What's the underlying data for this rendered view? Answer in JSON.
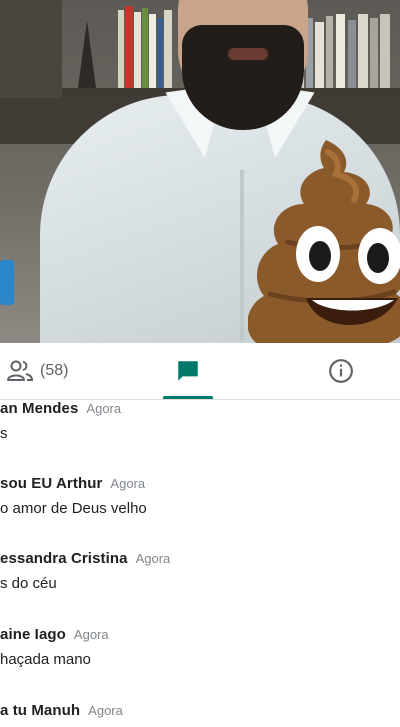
{
  "video": {
    "reaction_emoji": "pile-of-poo"
  },
  "tabs": {
    "people_count": "(58)",
    "people_icon": "people-icon",
    "chat_icon": "chat-icon",
    "info_icon": "info-icon",
    "accent": "#00796b"
  },
  "messages": [
    {
      "sender": "an Mendes",
      "time": "Agora",
      "text": "s"
    },
    {
      "sender": "sou EU Arthur",
      "time": "Agora",
      "text": "o amor de Deus velho"
    },
    {
      "sender": "essandra Cristina",
      "time": "Agora",
      "text": "s do céu"
    },
    {
      "sender": "aine Iago",
      "time": "Agora",
      "text": "haçada mano"
    },
    {
      "sender": "a tu Manuh",
      "time": "Agora",
      "text": ""
    }
  ]
}
